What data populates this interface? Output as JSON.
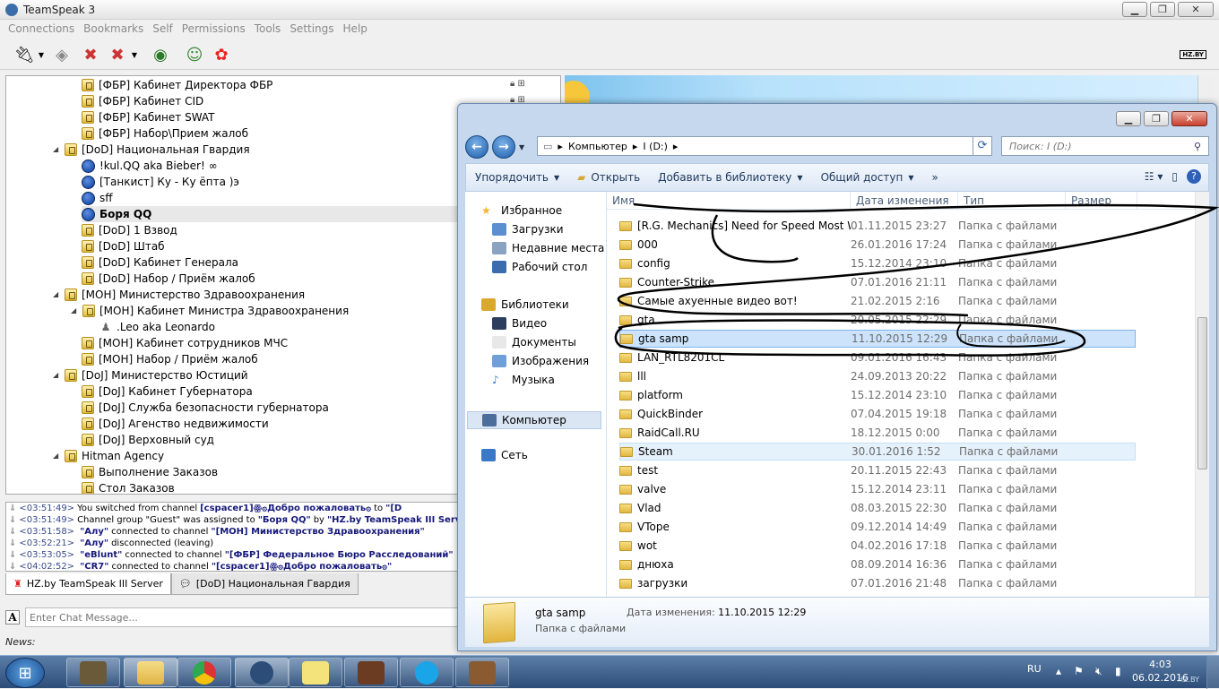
{
  "ts": {
    "title": "TeamSpeak 3",
    "menu": [
      "Connections",
      "Bookmarks",
      "Self",
      "Permissions",
      "Tools",
      "Settings",
      "Help"
    ],
    "logo": "HZ.BY",
    "tree": [
      {
        "t": "[ФБР] Кабинет Директора ФБР",
        "k": "ch",
        "l": 1
      },
      {
        "t": "[ФБР] Кабинет CID",
        "k": "ch",
        "l": 1
      },
      {
        "t": "[ФБР] Кабинет SWAT",
        "k": "ch",
        "l": 1
      },
      {
        "t": "[ФБР] Набор\\Прием жалоб",
        "k": "ch",
        "l": 1
      },
      {
        "t": "[DoD] Национальная Гвардия",
        "k": "ch",
        "l": 0,
        "exp": true
      },
      {
        "t": "!kul.QQ aka Bieber! ∞",
        "k": "u",
        "l": 1
      },
      {
        "t": "[Танкист] Ку - Ку ёпта )э",
        "k": "u",
        "l": 1
      },
      {
        "t": "sff",
        "k": "u",
        "l": 1
      },
      {
        "t": "Боря QQ",
        "k": "u",
        "l": 1,
        "sel": true
      },
      {
        "t": "[DoD] 1 Взвод",
        "k": "ch",
        "l": 1
      },
      {
        "t": "[DoD] Штаб",
        "k": "ch",
        "l": 1
      },
      {
        "t": "[DoD] Кабинет Генерала",
        "k": "ch",
        "l": 1
      },
      {
        "t": "[DoD] Набор / Приём жалоб",
        "k": "ch",
        "l": 1
      },
      {
        "t": "[МОН] Министерство Здравоохранения",
        "k": "ch",
        "l": 0,
        "exp": true
      },
      {
        "t": "[МОН] Кабинет Министра Здравоохранения",
        "k": "ch",
        "l": 1,
        "exp": true
      },
      {
        "t": ".Leo aka Leonardo",
        "k": "g",
        "l": 2
      },
      {
        "t": "[МОН] Кабинет сотрудников МЧС",
        "k": "ch",
        "l": 1
      },
      {
        "t": "[МОН] Набор / Приём жалоб",
        "k": "ch",
        "l": 1
      },
      {
        "t": "[DoJ] Министерство Юстиций",
        "k": "ch",
        "l": 0,
        "exp": true
      },
      {
        "t": "[DoJ] Кабинет Губернатора",
        "k": "ch",
        "l": 1
      },
      {
        "t": "[DoJ] Служба безопасности губернатора",
        "k": "ch",
        "l": 1
      },
      {
        "t": "[DoJ] Агенство недвижимости",
        "k": "ch",
        "l": 1
      },
      {
        "t": "[DoJ] Верховный суд",
        "k": "ch",
        "l": 1
      },
      {
        "t": "Hitman Agency",
        "k": "ch",
        "l": 0,
        "exp": true
      },
      {
        "t": "Выполнение Заказов",
        "k": "ch",
        "l": 1
      },
      {
        "t": "Стол Заказов",
        "k": "ch",
        "l": 1
      }
    ],
    "log": [
      {
        "tm": "<03:51:49>",
        "a": "You switched from channel",
        "n": "[cspacer1]ꙮ۞Добро пожаловать۞",
        "b": "to",
        "c": "\"[D"
      },
      {
        "tm": "<03:51:49>",
        "a": "Channel group \"Guest\" was assigned to",
        "n": "\"Боря QQ\"",
        "b": "by",
        "c": "\"HZ.by TeamSpeak III Serv"
      },
      {
        "tm": "<03:51:58>",
        "a": "",
        "n": "\"Алу\"",
        "b": "connected to channel",
        "c": "\"[МОН] Министерство Здравоохранения\""
      },
      {
        "tm": "<03:52:21>",
        "a": "",
        "n": "\"Алу\"",
        "b": "disconnected (leaving)",
        "c": ""
      },
      {
        "tm": "<03:53:05>",
        "a": "",
        "n": "\"eBlunt\"",
        "b": "connected to channel",
        "c": "\"[ФБР] Федеральное Бюро Расследований\""
      },
      {
        "tm": "<04:02:52>",
        "a": "",
        "n": "\"CR7\"",
        "b": "connected to channel",
        "c": "\"[cspacer1]ꙮ۞Добро пожаловать۞\""
      }
    ],
    "tabs": [
      "HZ.by TeamSpeak III Server",
      "[DoD] Национальная Гвардия"
    ],
    "chat_placeholder": "Enter Chat Message...",
    "news": "News:"
  },
  "explorer": {
    "path": [
      "Компьютер",
      "I (D:)"
    ],
    "search_placeholder": "Поиск: I (D:)",
    "cmds": [
      "Упорядочить",
      "Открыть",
      "Добавить в библиотеку",
      "Общий доступ",
      "»"
    ],
    "nav": [
      {
        "t": "Избранное",
        "ic": "★"
      },
      {
        "t": "Загрузки",
        "ic": ""
      },
      {
        "t": "Недавние места",
        "ic": ""
      },
      {
        "t": "Рабочий стол",
        "ic": ""
      },
      {
        "t": "Библиотеки",
        "ic": ""
      },
      {
        "t": "Видео",
        "ic": ""
      },
      {
        "t": "Документы",
        "ic": ""
      },
      {
        "t": "Изображения",
        "ic": ""
      },
      {
        "t": "Музыка",
        "ic": "♪"
      },
      {
        "t": "Компьютер",
        "ic": ""
      },
      {
        "t": "Сеть",
        "ic": ""
      }
    ],
    "cols": [
      "Имя",
      "Дата изменения",
      "Тип",
      "Размер"
    ],
    "files": [
      {
        "n": "[R.G. Mechanics] Need for Speed Most W...",
        "d": "01.11.2015 23:27",
        "t": "Папка с файлами"
      },
      {
        "n": "000",
        "d": "26.01.2016 17:24",
        "t": "Папка с файлами"
      },
      {
        "n": "config",
        "d": "15.12.2014 23:10",
        "t": "Папка с файлами"
      },
      {
        "n": "Counter-Strike",
        "d": "07.01.2016 21:11",
        "t": "Папка с файлами"
      },
      {
        "n": "Самые ахуенные видео вот!",
        "d": "21.02.2015 2:16",
        "t": "Папка с файлами"
      },
      {
        "n": "gta",
        "d": "20.05.2015 22:29",
        "t": "Папка с файлами"
      },
      {
        "n": "gta samp",
        "d": "11.10.2015 12:29",
        "t": "Папка с файлами",
        "sel": true
      },
      {
        "n": "LAN_RTL8201CL",
        "d": "09.01.2016 16:43",
        "t": "Папка с файлами"
      },
      {
        "n": "lll",
        "d": "24.09.2013 20:22",
        "t": "Папка с файлами"
      },
      {
        "n": "platform",
        "d": "15.12.2014 23:10",
        "t": "Папка с файлами"
      },
      {
        "n": "QuickBinder",
        "d": "07.04.2015 19:18",
        "t": "Папка с файлами"
      },
      {
        "n": "RaidCall.RU",
        "d": "18.12.2015 0:00",
        "t": "Папка с файлами"
      },
      {
        "n": "Steam",
        "d": "30.01.2016 1:52",
        "t": "Папка с файлами",
        "hov": true
      },
      {
        "n": "test",
        "d": "20.11.2015 22:43",
        "t": "Папка с файлами"
      },
      {
        "n": "valve",
        "d": "15.12.2014 23:11",
        "t": "Папка с файлами"
      },
      {
        "n": "Vlad",
        "d": "08.03.2015 22:30",
        "t": "Папка с файлами"
      },
      {
        "n": "VTope",
        "d": "09.12.2014 14:49",
        "t": "Папка с файлами"
      },
      {
        "n": "wot",
        "d": "04.02.2016 17:18",
        "t": "Папка с файлами"
      },
      {
        "n": "днюха",
        "d": "08.09.2014 16:36",
        "t": "Папка с файлами"
      },
      {
        "n": "загрузки",
        "d": "07.01.2016 21:48",
        "t": "Папка с файлами"
      }
    ],
    "details": {
      "name": "gta samp",
      "type": "Папка с файлами",
      "date_label": "Дата изменения:",
      "date": "11.10.2015 12:29"
    }
  },
  "taskbar": {
    "lang": "RU",
    "time": "4:03",
    "date": "06.02.2016",
    "watermark": "HZ.BY"
  }
}
